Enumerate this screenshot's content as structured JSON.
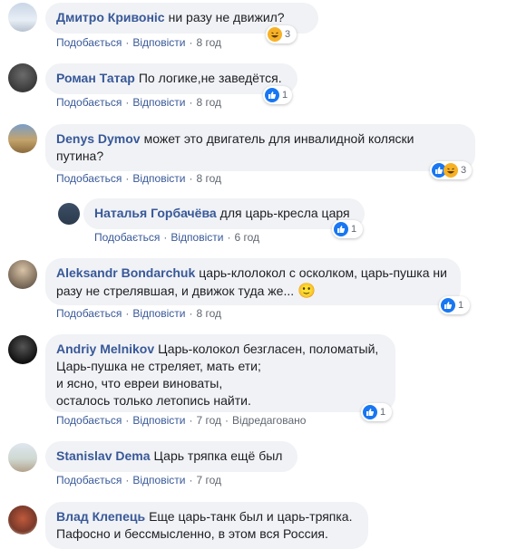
{
  "comments": [
    {
      "author": "Дмитро Кривоніс",
      "text": "ни разу не движил?",
      "like": "Подобається",
      "reply": "Відповісти",
      "time": "8 год",
      "reaction_count": "3",
      "reaction_icon": "haha-icon"
    },
    {
      "author": "Роман Татар",
      "text": "По логике,не заведётся.",
      "like": "Подобається",
      "reply": "Відповісти",
      "time": "8 год",
      "reaction_count": "1",
      "reaction_icon": "like-icon"
    },
    {
      "author": "Denys Dymov",
      "text_line1": "может это двигатель для инвалидной коляски",
      "text_line2": "путина?",
      "like": "Подобається",
      "reply": "Відповісти",
      "time": "8 год",
      "reaction_count": "3",
      "reaction_icons": [
        "like-icon",
        "haha-icon"
      ]
    },
    {
      "author": "Наталья Горбачёва",
      "text": "для царь-кресла царя",
      "like": "Подобається",
      "reply": "Відповісти",
      "time": "6 год",
      "reaction_count": "1",
      "reaction_icon": "like-icon"
    },
    {
      "author": "Aleksandr Bondarchuk",
      "text_line1": "царь-клолокол с осколком, царь-пушка ни",
      "text_line2": "разу не стрелявшая, и движок туда же...",
      "emoji": "🙂",
      "like": "Подобається",
      "reply": "Відповісти",
      "time": "8 год",
      "reaction_count": "1",
      "reaction_icon": "like-icon"
    },
    {
      "author": "Andriy Melnikov",
      "text_line1": "Царь-колокол безгласен, поломатый,",
      "text_line2": "Царь-пушка не стреляет, мать ети;",
      "text_line3": "и ясно, что евреи виноваты,",
      "text_line4": "осталось только летопись найти.",
      "like": "Подобається",
      "reply": "Відповісти",
      "time": "7 год",
      "edited": "Відредаговано",
      "reaction_count": "1",
      "reaction_icon": "like-icon"
    },
    {
      "author": "Stanislav Dema",
      "text": "Царь тряпка ещё был",
      "like": "Подобається",
      "reply": "Відповісти",
      "time": "7 год"
    },
    {
      "author": "Влад Клепець",
      "text_line1": "Еще царь-танк был и царь-тряпка.",
      "text_line2": "Пафосно и бессмысленно, в этом вся Россия."
    }
  ],
  "colors": {
    "author": "#385898",
    "bubble": "#f0f2f5",
    "meta": "#606770",
    "like": "#1877f2",
    "haha": "#f7b125"
  }
}
